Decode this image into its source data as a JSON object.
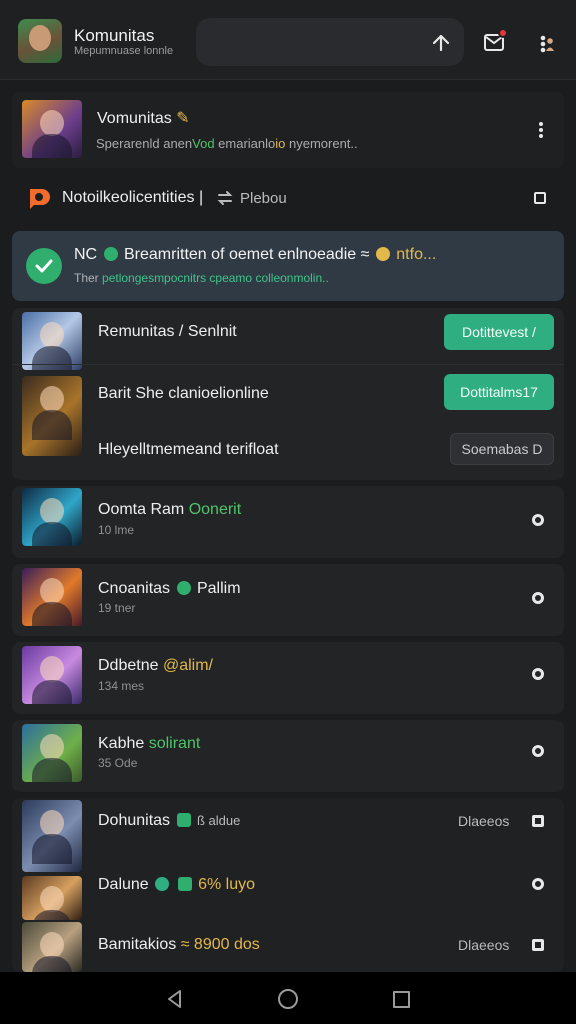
{
  "header": {
    "title": "Komunitas",
    "subtitle": "Mepumnuase lonnle"
  },
  "featured": {
    "title": "Vomunitas",
    "subtitle_pre": "Sperarenld anen",
    "subtitle_green": "Vod",
    "subtitle_mid": " emarianlo",
    "subtitle_orange": "io",
    "subtitle_post": " nyemorent.."
  },
  "section": {
    "label": "Notoilkeolicentities |",
    "sublabel": "Plebou"
  },
  "banner": {
    "title_pre": "NC",
    "title": " Breamritten of oemet enlnoeadie ≈",
    "title_post": " ntfo...",
    "sub_pre": "Ther",
    "sub": " petlongesmpocnitrs cpeamo colleonmolin.."
  },
  "group": {
    "row1_title": "Remunitas / Senlnit",
    "row1_button": "Dotittevest /",
    "row2_title": "Barit She clanioelionline",
    "row2_button": "Dottitalms17",
    "row3_title": "Hleyelltmemeand terifloat",
    "row3_button": "Soemabas D"
  },
  "list": [
    {
      "title": "Oomta Ram",
      "title_accent": "Oonerit",
      "sub": "10 lme"
    },
    {
      "title": "Cnoanitas",
      "title_accent": "Pallim",
      "sub": "19 tner"
    },
    {
      "title": "Ddbetne",
      "title_accent": "@alim/",
      "sub": "134 mes"
    },
    {
      "title": "Kabhe",
      "title_accent": "solirant",
      "sub": "35 Ode"
    },
    {
      "title": "Dohunitas",
      "title_accent": "ß aldue",
      "action": "Dlaeeos"
    },
    {
      "title": "Dalune",
      "title_accent": "6% luyo",
      "action": ""
    },
    {
      "title": "Bamitakios",
      "title_accent": "≈ 8900 dos",
      "action": "Dlaeeos"
    }
  ],
  "colors": {
    "accent_green": "#2fae82",
    "badge_red": "#e53935",
    "banner_bg": "#303a44"
  }
}
